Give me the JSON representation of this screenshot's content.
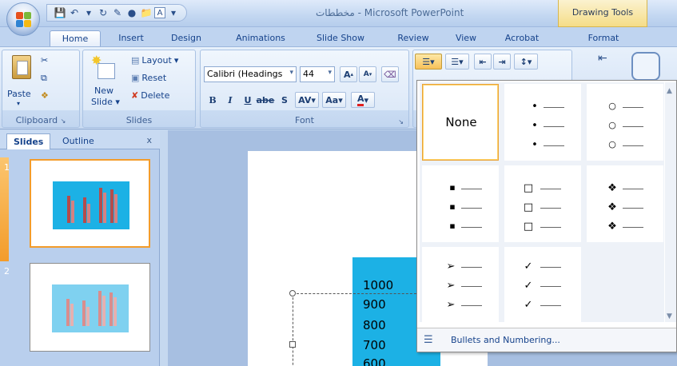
{
  "window": {
    "title": "مخططات - Microsoft PowerPoint",
    "context_tab_group": "Drawing Tools"
  },
  "tabs": [
    "Home",
    "Insert",
    "Design",
    "Animations",
    "Slide Show",
    "Review",
    "View",
    "Acrobat",
    "Format"
  ],
  "active_tab": "Home",
  "ribbon": {
    "clipboard": {
      "label": "Clipboard",
      "paste": "Paste"
    },
    "slides": {
      "label": "Slides",
      "new_slide_line1": "New",
      "new_slide_line2": "Slide",
      "layout": "Layout",
      "reset": "Reset",
      "delete": "Delete"
    },
    "font": {
      "label": "Font",
      "font_name": "Calibri (Headings",
      "font_size": "44",
      "bold": "B",
      "italic": "I",
      "underline": "U",
      "strike": "abe",
      "shadow": "S",
      "spacing": "AV",
      "case": "Aa",
      "color": "A",
      "grow": "A",
      "shrink": "A"
    }
  },
  "slides_pane": {
    "tab_slides": "Slides",
    "tab_outline": "Outline",
    "close": "x",
    "thumbs": [
      {
        "num": "1"
      },
      {
        "num": "2"
      }
    ]
  },
  "canvas": {
    "y_ticks": [
      "1000",
      "900",
      "800",
      "700",
      "600"
    ]
  },
  "bullet_menu": {
    "none_label": "None",
    "footer": "Bullets and Numbering...",
    "styles": [
      {
        "id": "none"
      },
      {
        "id": "filled-round",
        "marker": "•"
      },
      {
        "id": "hollow-round",
        "marker": "○"
      },
      {
        "id": "filled-square",
        "marker": "▪"
      },
      {
        "id": "hollow-square",
        "marker": "□"
      },
      {
        "id": "four-diamond",
        "marker": "❖"
      },
      {
        "id": "arrow",
        "marker": "➢"
      },
      {
        "id": "checkmark",
        "marker": "✓"
      }
    ]
  },
  "colors": {
    "accent_selected": "#e9a33a",
    "slide_chart_bg": "#1cb1e5",
    "thumb_selected": "#f39c2b"
  }
}
